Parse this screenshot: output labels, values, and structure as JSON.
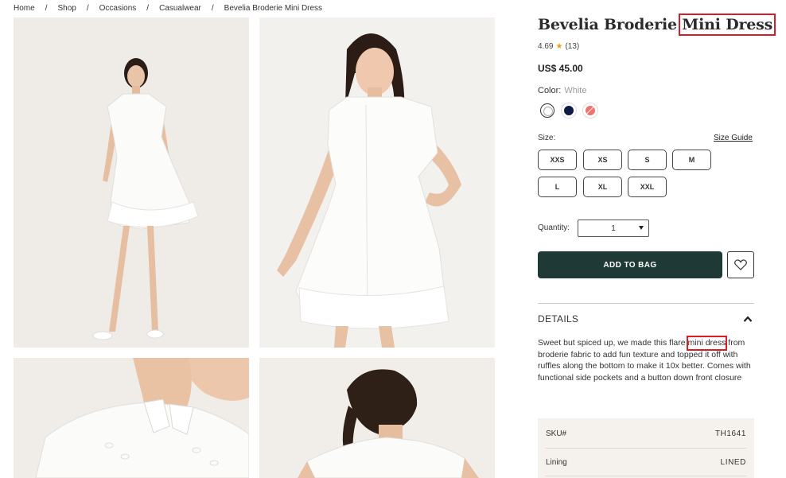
{
  "breadcrumb": [
    "Home",
    "Shop",
    "Occasions",
    "Casualwear",
    "Bevelia Broderie Mini Dress"
  ],
  "product": {
    "title_prefix": "Bevelia Broderie ",
    "title_highlight": "Mini Dress",
    "rating": "4.69",
    "review_count": "(13)",
    "price": "US$ 45.00"
  },
  "color": {
    "label": "Color:",
    "selected": "White",
    "swatches": [
      "white",
      "navy",
      "coral"
    ]
  },
  "size": {
    "label": "Size:",
    "guide": "Size Guide",
    "options": [
      "XXS",
      "XS",
      "S",
      "M",
      "L",
      "XL",
      "XXL"
    ]
  },
  "quantity": {
    "label": "Quantity:",
    "value": "1"
  },
  "actions": {
    "add_to_bag": "ADD TO BAG"
  },
  "details": {
    "heading": "DETAILS",
    "desc_before": "Sweet but spiced up, we made this flare ",
    "desc_highlight": "mini dress",
    "desc_after": " from broderie fabric to add fun texture and topped it off with ruffles along the bottom to make it 10x better. Comes with functional side pockets and a button down front closure"
  },
  "specs": [
    {
      "label": "SKU#",
      "value": "TH1641"
    },
    {
      "label": "Lining",
      "value": "LINED"
    }
  ],
  "colors": {
    "accent": "#1f3a36",
    "highlight": "#d91c2a",
    "star": "#e6a21a"
  }
}
